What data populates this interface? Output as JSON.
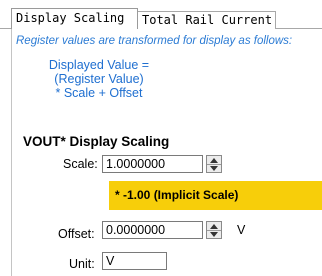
{
  "tabs": [
    {
      "label": "Display Scaling",
      "active": true
    },
    {
      "label": "Total Rail Current",
      "active": false
    }
  ],
  "description": "Register values are transformed for display as follows:",
  "formula": {
    "line1": "Displayed Value =",
    "line2": "(Register Value)",
    "line3": "* Scale + Offset"
  },
  "section": {
    "title": "VOUT* Display Scaling",
    "scale_label": "Scale:",
    "scale_value": "1.0000000",
    "implicit_scale": "* -1.00 (Implicit Scale)",
    "offset_label": "Offset:",
    "offset_value": "0.0000000",
    "offset_unit": "V",
    "unit_label": "Unit:",
    "unit_value": "V"
  },
  "colors": {
    "description_text": "#2b7bd4",
    "formula_text": "#1f6fd0",
    "implicit_highlight": "#f7ce0a"
  }
}
